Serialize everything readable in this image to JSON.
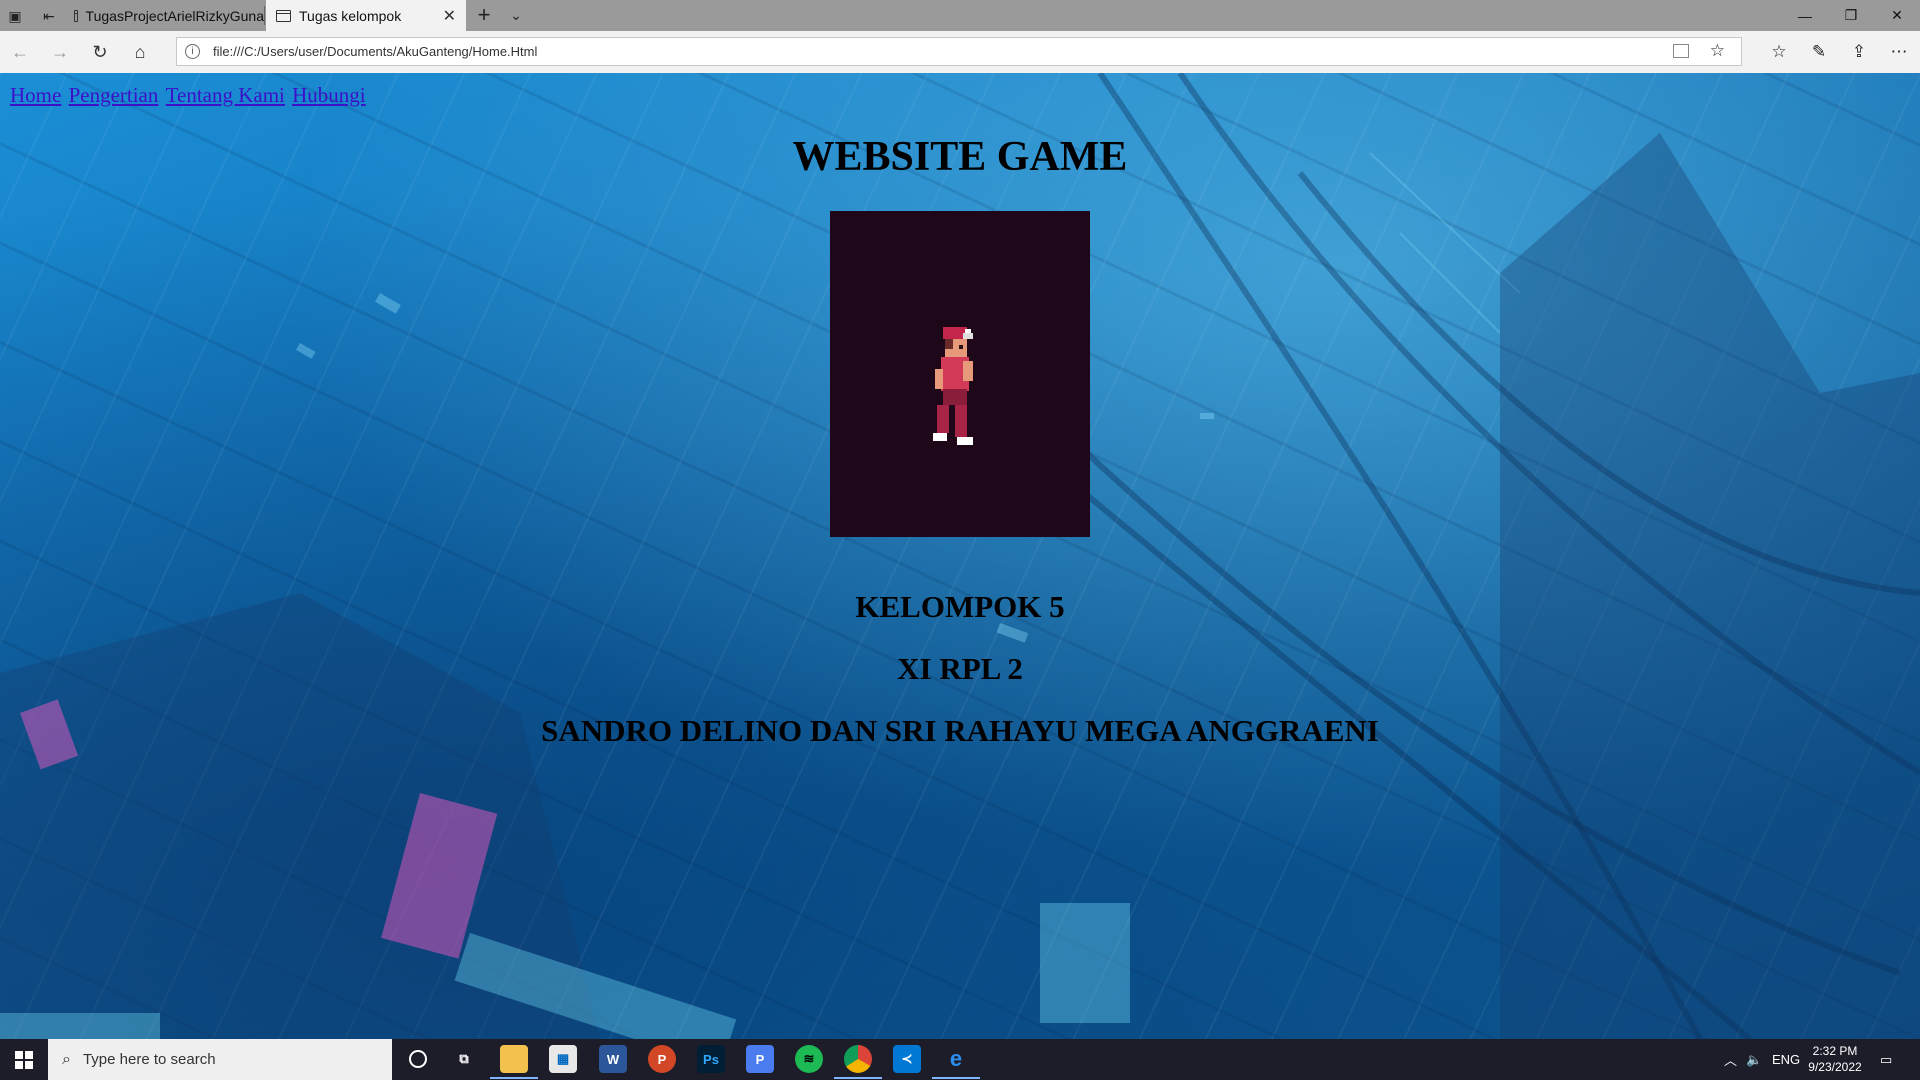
{
  "browser": {
    "tabs": [
      {
        "label": "TugasProjectArielRizkyGuna"
      },
      {
        "label": "Tugas kelompok"
      }
    ],
    "address": "file:///C:/Users/user/Documents/AkuGanteng/Home.Html"
  },
  "page": {
    "nav": [
      "Home",
      "Pengertian",
      "Tentang Kami",
      "Hubungi"
    ],
    "title": "WEBSITE GAME",
    "group": "KELOMPOK 5",
    "class": "XI RPL 2",
    "members": "SANDRO DELINO DAN SRI RAHAYU MEGA ANGGRAENI"
  },
  "taskbar": {
    "search_placeholder": "Type here to search",
    "language": "ENG",
    "time": "2:32 PM",
    "date": "9/23/2022",
    "apps": [
      "cortana-icon",
      "task-view-icon",
      "file-explorer-icon",
      "store-icon",
      "word-icon",
      "powerpoint-icon",
      "photoshop-icon",
      "pixiv-icon",
      "spotify-icon",
      "chrome-icon",
      "vscode-icon",
      "edge-icon"
    ]
  },
  "colors": {
    "link": "#3b10c8",
    "game_frame": "#1e0718"
  }
}
